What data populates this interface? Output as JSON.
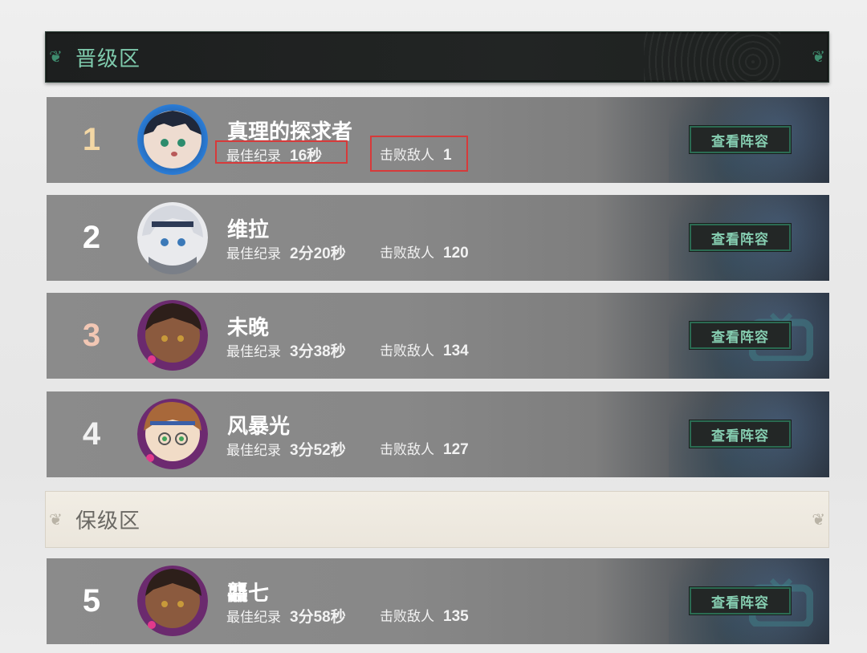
{
  "sections": {
    "promotion_title": "晋级区",
    "relegation_title": "保级区"
  },
  "view_button_label": "查看阵容",
  "best_record_label": "最佳纪录",
  "defeated_label": "击败敌人",
  "players": [
    {
      "rank": "1",
      "name": "真理的探求者",
      "best_record": "16秒",
      "defeated": "1",
      "rank_color": "#f3d7a4"
    },
    {
      "rank": "2",
      "name": "维拉",
      "best_record": "2分20秒",
      "defeated": "120",
      "rank_color": "#ffffff"
    },
    {
      "rank": "3",
      "name": "未晚",
      "best_record": "3分38秒",
      "defeated": "134",
      "rank_color": "#f2c7b4"
    },
    {
      "rank": "4",
      "name": "风暴光",
      "best_record": "3分52秒",
      "defeated": "127",
      "rank_color": "#f1f1f1"
    },
    {
      "rank": "5",
      "name": "龘七",
      "best_record": "3分58秒",
      "defeated": "135",
      "rank_color": "#ffffff"
    }
  ],
  "colors": {
    "accent_green": "#86ceb1",
    "highlight_red": "#d73a3a"
  }
}
